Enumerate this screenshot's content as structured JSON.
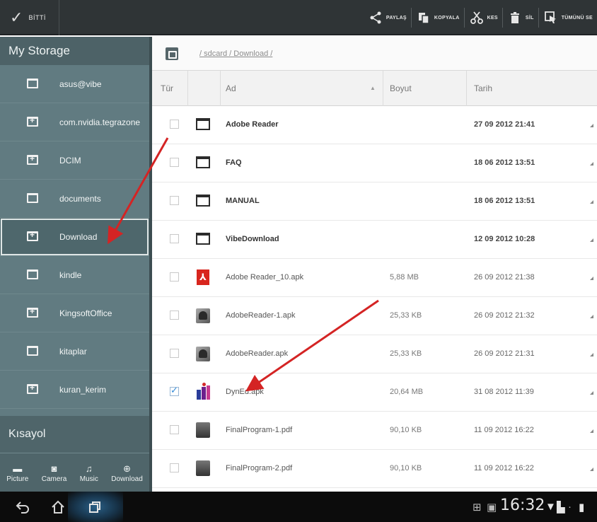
{
  "topbar": {
    "done_label": "BİTTİ",
    "actions": [
      {
        "label": "PAYLAŞ",
        "icon": "share-icon"
      },
      {
        "label": "KOPYALA",
        "icon": "copy-icon"
      },
      {
        "label": "KES",
        "icon": "cut-icon"
      },
      {
        "label": "SİL",
        "icon": "trash-icon"
      },
      {
        "label": "TÜMÜNÜ SE",
        "icon": "select-all-icon"
      }
    ]
  },
  "sidebar": {
    "heading": "My Storage",
    "items": [
      {
        "label": "asus@vibe",
        "icon": "folder-icon"
      },
      {
        "label": "com.nvidia.tegrazone",
        "icon": "folder-plus-icon"
      },
      {
        "label": "DCIM",
        "icon": "folder-plus-icon"
      },
      {
        "label": "documents",
        "icon": "folder-icon"
      },
      {
        "label": "Download",
        "icon": "folder-plus-icon",
        "selected": true
      },
      {
        "label": "kindle",
        "icon": "folder-icon"
      },
      {
        "label": "KingsoftOffice",
        "icon": "folder-plus-icon"
      },
      {
        "label": "kitaplar",
        "icon": "folder-icon"
      },
      {
        "label": "kuran_kerim",
        "icon": "folder-plus-icon"
      }
    ],
    "shortcuts_heading": "Kısayol",
    "shortcuts": [
      {
        "label": "Picture",
        "icon": "picture-icon"
      },
      {
        "label": "Camera",
        "icon": "camera-icon"
      },
      {
        "label": "Music",
        "icon": "music-icon"
      },
      {
        "label": "Download",
        "icon": "download-icon"
      }
    ]
  },
  "main": {
    "path": "/ sdcard / Download /",
    "columns": {
      "type": "Tür",
      "name": "Ad",
      "size": "Boyut",
      "date": "Tarih"
    },
    "rows": [
      {
        "name": "Adobe Reader",
        "size": "",
        "date": "27 09 2012 21:41",
        "kind": "folder",
        "checked": false
      },
      {
        "name": "FAQ",
        "size": "",
        "date": "18 06 2012 13:51",
        "kind": "folder",
        "checked": false
      },
      {
        "name": "MANUAL",
        "size": "",
        "date": "18 06 2012 13:51",
        "kind": "folder",
        "checked": false
      },
      {
        "name": "VibeDownload",
        "size": "",
        "date": "12 09 2012 10:28",
        "kind": "folder",
        "checked": false
      },
      {
        "name": "Adobe Reader_10.apk",
        "size": "5,88 MB",
        "date": "26 09 2012 21:38",
        "kind": "pdf-app",
        "checked": false
      },
      {
        "name": "AdobeReader-1.apk",
        "size": "25,33 KB",
        "date": "26 09 2012 21:32",
        "kind": "apk",
        "checked": false
      },
      {
        "name": "AdobeReader.apk",
        "size": "25,33 KB",
        "date": "26 09 2012 21:31",
        "kind": "apk",
        "checked": false
      },
      {
        "name": "DynEd.apk",
        "size": "20,64 MB",
        "date": "31 08 2012 11:39",
        "kind": "dyned",
        "checked": true
      },
      {
        "name": "FinalProgram-1.pdf",
        "size": "90,10 KB",
        "date": "11 09 2012 16:22",
        "kind": "pdf",
        "checked": false
      },
      {
        "name": "FinalProgram-2.pdf",
        "size": "90,10 KB",
        "date": "11 09 2012 16:22",
        "kind": "pdf",
        "checked": false
      }
    ]
  },
  "system": {
    "clock": "16:32"
  }
}
